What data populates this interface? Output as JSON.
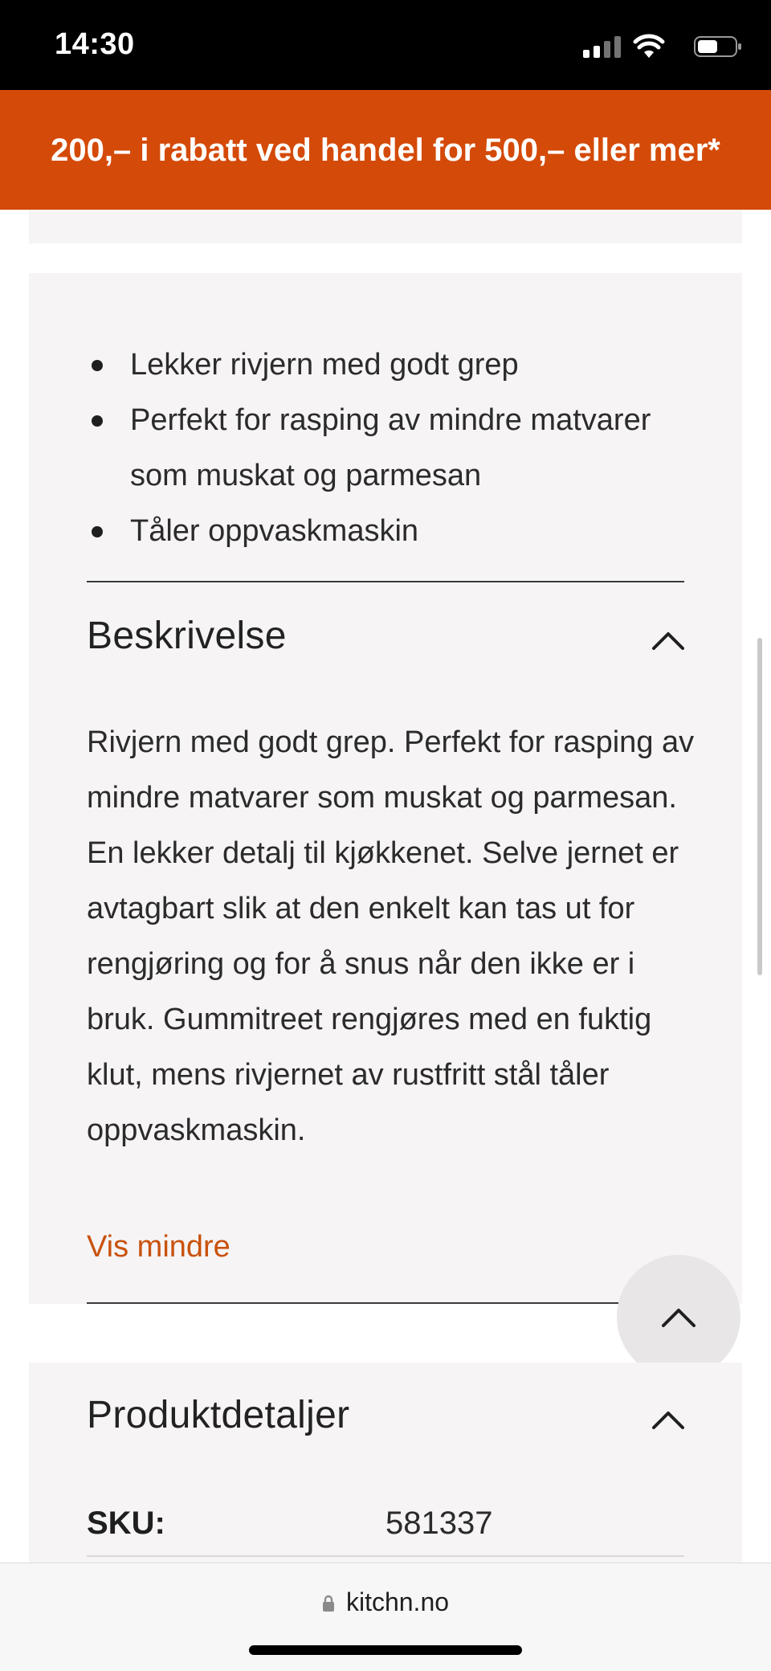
{
  "status_bar": {
    "time": "14:30"
  },
  "promo_banner": {
    "text": "200,– i rabatt ved handel for 500,– eller mer*",
    "background": "#d44a08"
  },
  "highlights": [
    "Lekker rivjern med godt grep",
    "Perfekt for rasping av mindre matvarer som muskat og parmesan",
    "Tåler oppvaskmaskin"
  ],
  "description_section": {
    "title": "Beskrivelse",
    "body": "Rivjern med godt grep. Perfekt for rasping av mindre matvarer som muskat og parmesan. En lekker detalj til kjøkkenet. Selve jernet er avtagbart slik at den enkelt kan tas ut for rengjøring og for å snus når den ikke er i bruk. Gummitreet rengjøres med en fuktig klut, mens rivjernet av rustfritt stål tåler oppvaskmaskin.",
    "toggle_label": "Vis mindre",
    "toggle_color": "#c9520e",
    "expanded": true
  },
  "details_section": {
    "title": "Produktdetaljer",
    "expanded": true,
    "rows": [
      {
        "label": "SKU:",
        "value": "581337"
      }
    ]
  },
  "scroll_top_button": {
    "icon": "chevron-up-icon"
  },
  "browser": {
    "url": "kitchn.no",
    "icon": "lock-icon"
  }
}
